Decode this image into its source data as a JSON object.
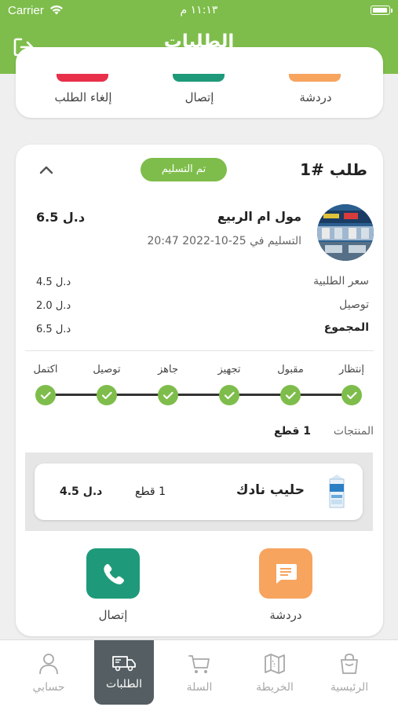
{
  "status_bar": {
    "carrier": "Carrier",
    "time": "١١:١٣ م"
  },
  "header": {
    "title": "الطلبات"
  },
  "top_card": {
    "buttons": [
      {
        "label": "إلغاء الطلب",
        "color": "#e8304a"
      },
      {
        "label": "إتصال",
        "color": "#1e9a7a"
      },
      {
        "label": "دردشة",
        "color": "#f7a45f"
      }
    ]
  },
  "order": {
    "title": "طلب #1",
    "status": "تم التسليم",
    "store_name": "مول ام الربيع",
    "total": "6.5 د.ل",
    "delivery_date": "التسليم في 25-10-2022   20:47",
    "pricing": [
      {
        "label": "سعر الطلبية",
        "value": "4.5 د.ل"
      },
      {
        "label": "توصيل",
        "value": "2.0 د.ل"
      },
      {
        "label": "المجموع",
        "value": "6.5 د.ل"
      }
    ],
    "steps": [
      "إنتظار",
      "مقبول",
      "تجهيز",
      "جاهز",
      "توصيل",
      "اكتمل"
    ],
    "products_label": "المنتجات",
    "products_count": "1 قطع",
    "products": [
      {
        "name": "حليب نادك",
        "qty": "1 قطع",
        "price": "4.5 د.ل"
      }
    ],
    "actions": [
      {
        "label": "دردشة",
        "color": "#f7a45f"
      },
      {
        "label": "إتصال",
        "color": "#1e9a7a"
      }
    ]
  },
  "tabs": [
    {
      "label": "الرئيسية",
      "icon": "bag-icon"
    },
    {
      "label": "الخريطة",
      "icon": "map-icon"
    },
    {
      "label": "السلة",
      "icon": "cart-icon"
    },
    {
      "label": "الطلبات",
      "icon": "truck-icon",
      "active": true
    },
    {
      "label": "حسابي",
      "icon": "user-icon"
    }
  ],
  "colors": {
    "primary": "#7ebd4b",
    "active_tab": "#555e62"
  }
}
